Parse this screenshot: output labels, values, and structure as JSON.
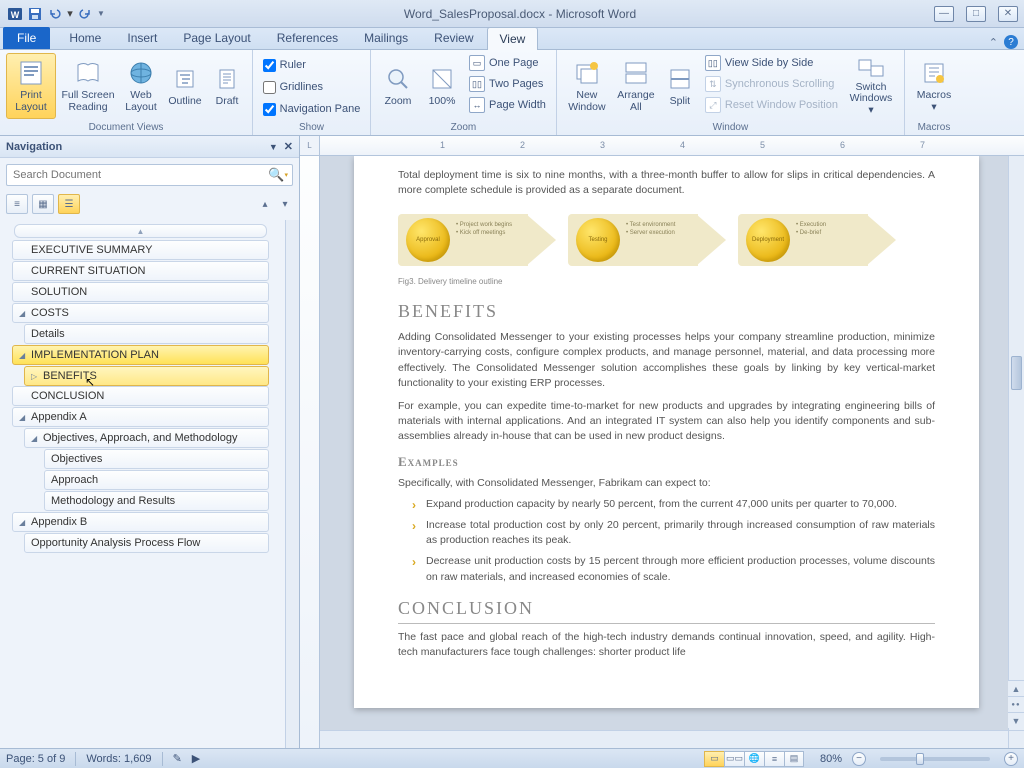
{
  "title": "Word_SalesProposal.docx - Microsoft Word",
  "tabs": {
    "file": "File",
    "home": "Home",
    "insert": "Insert",
    "page_layout": "Page Layout",
    "references": "References",
    "mailings": "Mailings",
    "review": "Review",
    "view": "View"
  },
  "ribbon": {
    "document_views": {
      "label": "Document Views",
      "print_layout": "Print Layout",
      "full_screen_reading": "Full Screen Reading",
      "web_layout": "Web Layout",
      "outline": "Outline",
      "draft": "Draft"
    },
    "show": {
      "label": "Show",
      "ruler": "Ruler",
      "gridlines": "Gridlines",
      "navigation_pane": "Navigation Pane"
    },
    "zoom": {
      "label": "Zoom",
      "zoom": "Zoom",
      "hundred": "100%",
      "one_page": "One Page",
      "two_pages": "Two Pages",
      "page_width": "Page Width"
    },
    "window": {
      "label": "Window",
      "new_window": "New Window",
      "arrange_all": "Arrange All",
      "split": "Split",
      "view_side": "View Side by Side",
      "sync_scroll": "Synchronous Scrolling",
      "reset_pos": "Reset Window Position",
      "switch_windows": "Switch Windows"
    },
    "macros": {
      "label": "Macros",
      "macros": "Macros"
    }
  },
  "navigation": {
    "title": "Navigation",
    "search_placeholder": "Search Document",
    "items": {
      "exec": "EXECUTIVE SUMMARY",
      "current": "CURRENT SITUATION",
      "solution": "SOLUTION",
      "costs": "COSTS",
      "details": "Details",
      "impl": "IMPLEMENTATION PLAN",
      "benefits": "BENEFITS",
      "conclusion": "CONCLUSION",
      "appA": "Appendix A",
      "oam": "Objectives, Approach, and Methodology",
      "objectives": "Objectives",
      "approach": "Approach",
      "method": "Methodology and Results",
      "appB": "Appendix B",
      "opp": "Opportunity Analysis Process Flow"
    }
  },
  "document": {
    "intro1": "Total deployment time is six to nine months, with a three-month buffer to allow for slips in critical dependencies. A more complete schedule is provided as a separate document.",
    "diagram": {
      "s1": {
        "label": "Approval",
        "b1": "Project work begins",
        "b2": "Kick off meetings"
      },
      "s2": {
        "label": "Testing",
        "b1": "Test environment",
        "b2": "Server execution"
      },
      "s3": {
        "label": "Deployment",
        "b1": "Execution",
        "b2": "De-brief"
      }
    },
    "fig_caption": "Fig3. Delivery timeline outline",
    "h_benefits": "BENEFITS",
    "benefits_p1": "Adding Consolidated Messenger to your existing processes helps your company streamline production, minimize inventory-carrying costs, configure complex products, and manage personnel, material, and data processing more effectively. The Consolidated Messenger solution accomplishes these goals by linking by key vertical-market functionality to your existing ERP processes.",
    "benefits_p2": "For example, you can expedite time-to-market for new products and upgrades by integrating engineering bills of materials with internal applications. And an integrated IT system can also help you identify components and sub-assemblies already in-house that can be used in new product designs.",
    "h_examples": "Examples",
    "examples_intro": "Specifically, with Consolidated Messenger, Fabrikam can expect to:",
    "ex1": "Expand production capacity by nearly 50 percent, from the current 47,000 units per quarter to 70,000.",
    "ex2": "Increase total production cost by only 20 percent, primarily through increased consumption of raw materials as production reaches its peak.",
    "ex3": "Decrease unit production costs by 15 percent through more efficient production processes, volume discounts on raw materials, and increased economies of scale.",
    "h_conclusion": "CONCLUSION",
    "conclusion_p1": "The fast pace and global reach of the high-tech industry demands continual innovation, speed, and agility. High-tech manufacturers face tough challenges: shorter product life"
  },
  "statusbar": {
    "page": "Page: 5 of 9",
    "words": "Words: 1,609",
    "zoom": "80%"
  }
}
